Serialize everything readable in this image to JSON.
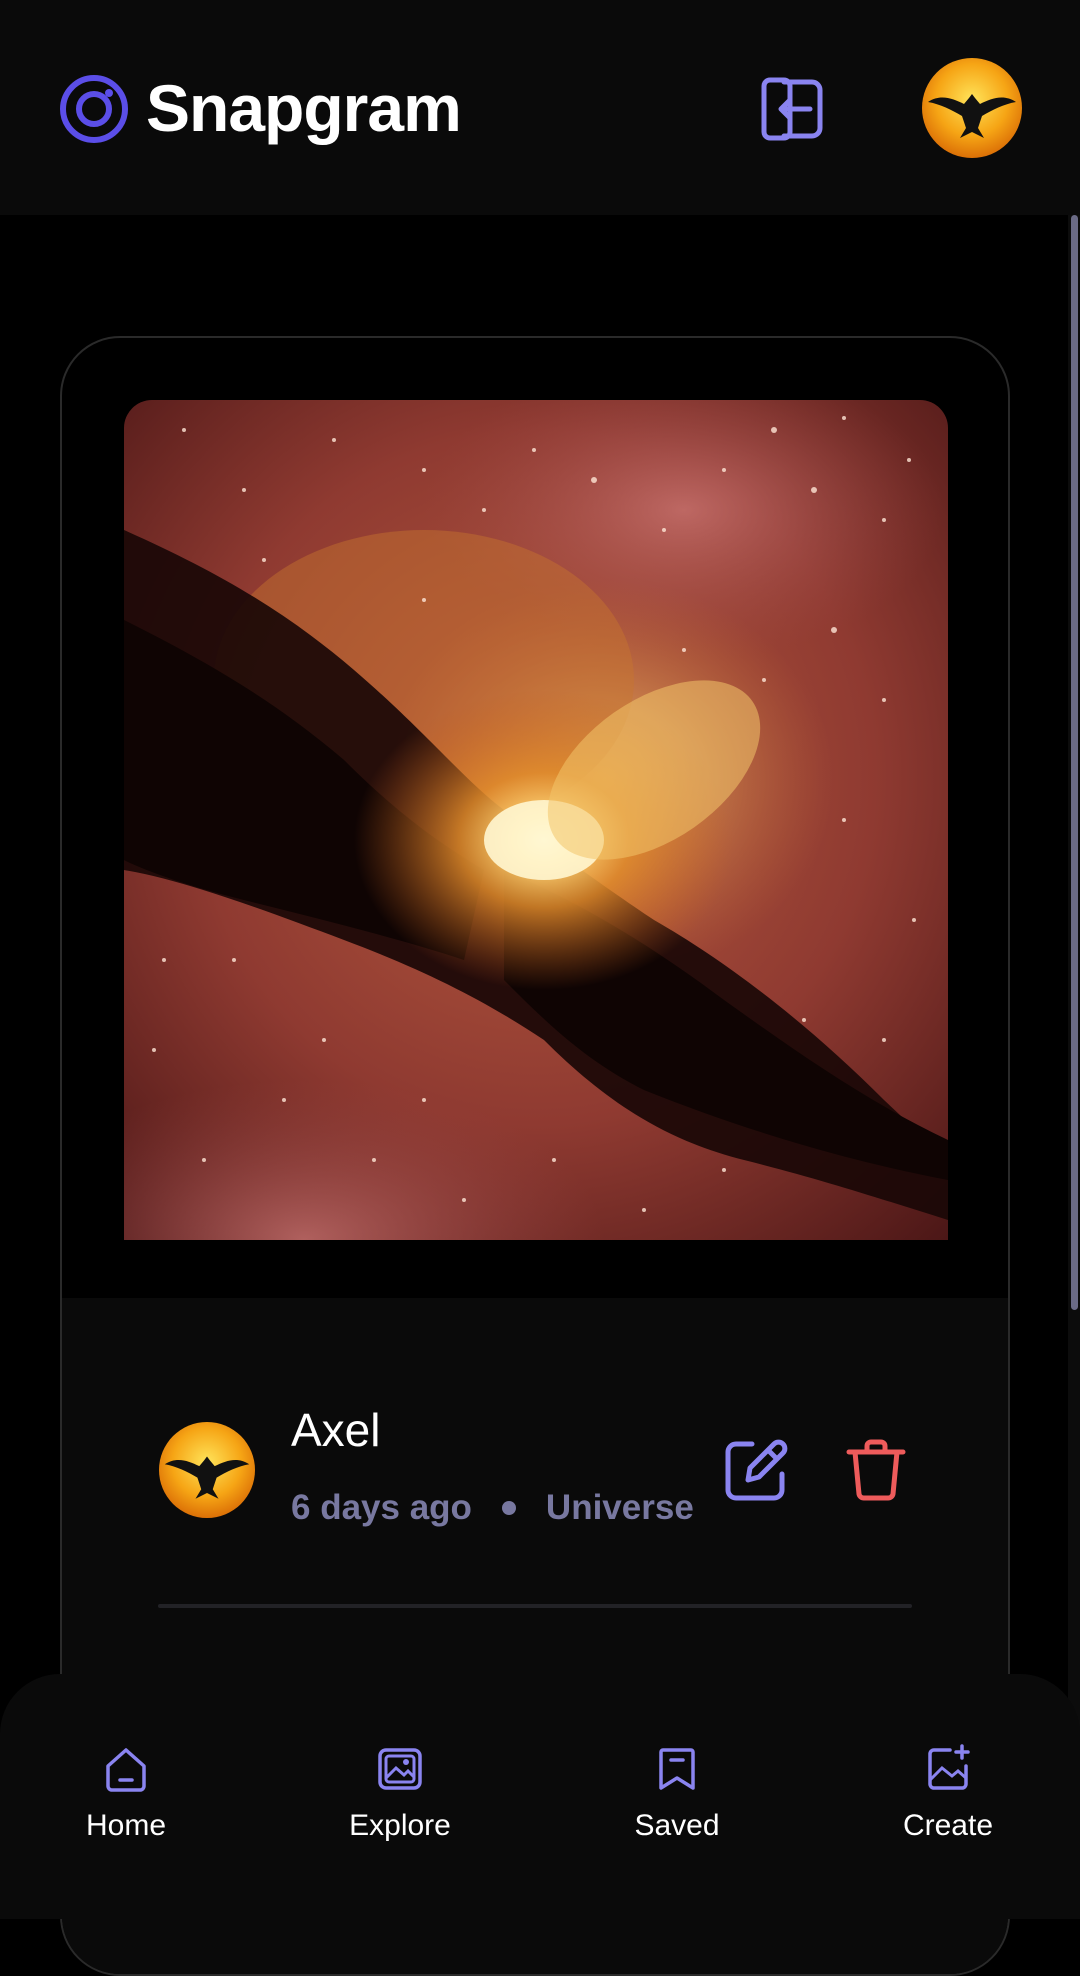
{
  "app": {
    "title": "Snapgram",
    "accent_color": "#5b4ee8",
    "icon_color": "#8a84f0",
    "danger_color": "#ee5b5b"
  },
  "topbar": {
    "logo_icon": "snapgram-logo-icon",
    "logout_icon": "logout-icon",
    "avatar_icon": "user-avatar"
  },
  "post": {
    "image": "nebula-photo",
    "author": "Axel",
    "time_ago": "6 days ago",
    "location": "Universe",
    "edit_icon": "edit-icon",
    "delete_icon": "trash-icon"
  },
  "bottom_nav": {
    "items": [
      {
        "label": "Home",
        "icon": "home-icon"
      },
      {
        "label": "Explore",
        "icon": "explore-icon"
      },
      {
        "label": "Saved",
        "icon": "bookmark-icon"
      },
      {
        "label": "Create",
        "icon": "create-icon"
      }
    ]
  }
}
